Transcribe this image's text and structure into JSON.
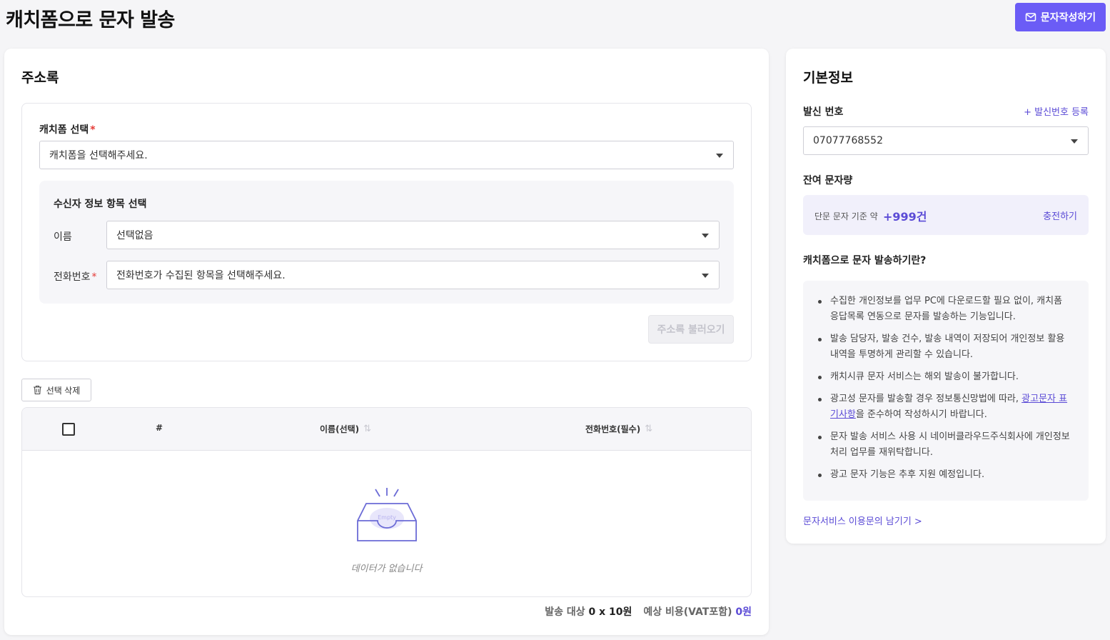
{
  "header": {
    "title": "캐치폼으로 문자 발송",
    "compose_label": "문자작성하기"
  },
  "address_book": {
    "title": "주소록",
    "form_select_label": "캐치폼 선택",
    "required_mark": "*",
    "form_select_value": "캐치폼을 선택해주세요.",
    "recipient_section_title": "수신자 정보 항목 선택",
    "name_label": "이름",
    "name_value": "선택없음",
    "phone_label": "전화번호",
    "phone_value": "전화번호가 수집된 항목을 선택해주세요.",
    "load_button": "주소록 불러오기",
    "delete_button": "선택 삭제",
    "table": {
      "columns": [
        "#",
        "이름(선택)",
        "전화번호(필수)"
      ],
      "sort_icon": "⇅",
      "rows": [],
      "empty_badge": "Empty",
      "empty_text": "데이터가 없습니다"
    },
    "summary": {
      "target_label": "발송 대상",
      "target_value": "0 x 10원",
      "cost_label": "예상 비용(VAT포함)",
      "cost_value": "0원"
    }
  },
  "basic_info": {
    "title": "기본정보",
    "sender_label": "발신 번호",
    "register_link": "+ 발신번호 등록",
    "sender_value": "07077768552",
    "balance_label": "잔여 문자량",
    "balance_prefix": "단문 문자 기준 약",
    "balance_value": "+999건",
    "charge_link": "충전하기",
    "about_title": "캐치폼으로 문자 발송하기란?",
    "notes": [
      {
        "text": "수집한 개인정보를 업무 PC에 다운로드할 필요 없이, 캐치폼 응답목록 연동으로 문자를 발송하는 기능입니다."
      },
      {
        "text": "발송 담당자, 발송 건수, 발송 내역이 저장되어 개인정보 활용내역을 투명하게 관리할 수 있습니다."
      },
      {
        "text": "캐치시큐 문자 서비스는 해외 발송이 불가합니다."
      },
      {
        "before": "광고성 문자를 발송할 경우 정보통신망법에 따라, ",
        "link": "광고문자 표기사항",
        "after": "을 준수하여 작성하시기 바랍니다."
      },
      {
        "text": "문자 발송 서비스 사용 시 네이버클라우드주식회사에 개인정보 처리 업무를 재위탁합니다."
      },
      {
        "text": "광고 문자 기능은 추후 지원 예정입니다."
      }
    ],
    "feedback_link": "문자서비스 이용문의 남기기 >"
  },
  "colors": {
    "accent": "#6b5cf6",
    "link": "#5b4bd6",
    "required": "#e53935"
  }
}
